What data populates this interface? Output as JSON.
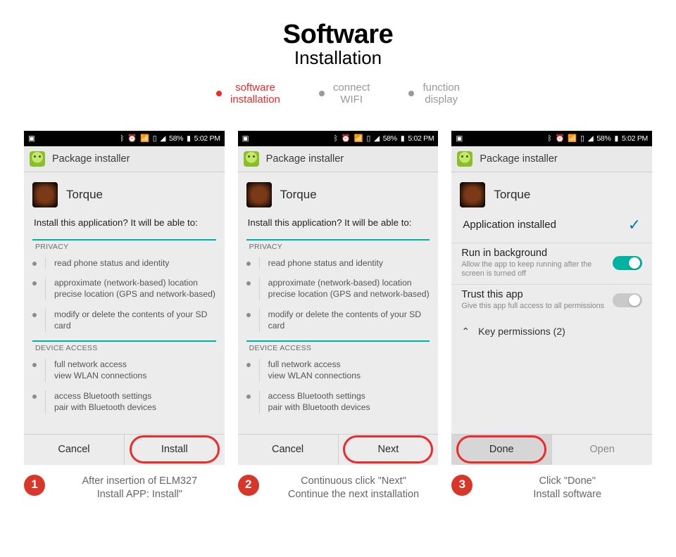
{
  "header": {
    "title": "Software",
    "subtitle": "Installation"
  },
  "tabs": {
    "t1a": "software",
    "t1b": "installation",
    "t2a": "connect",
    "t2b": "WIFI",
    "t3a": "function",
    "t3b": "display"
  },
  "statusbar": {
    "battery": "58%",
    "time": "5:02 PM"
  },
  "installer": {
    "header": "Package installer",
    "app_name": "Torque",
    "question": "Install this application? It will be able to:",
    "sect_privacy": "PRIVACY",
    "sect_device": "DEVICE ACCESS",
    "perm1": "read phone status and identity",
    "perm2a": "approximate (network-based) location",
    "perm2b": "precise location (GPS and network-based)",
    "perm3": "modify or delete the contents of your SD card",
    "perm4a": "full network access",
    "perm4b": "view WLAN connections",
    "perm5a": "access Bluetooth settings",
    "perm5b": "pair with Bluetooth devices"
  },
  "buttons": {
    "cancel": "Cancel",
    "install": "Install",
    "next": "Next",
    "done": "Done",
    "open": "Open"
  },
  "done_screen": {
    "installed": "Application installed",
    "run_bg_title": "Run in background",
    "run_bg_desc": "Allow the app to keep running after the screen is turned off",
    "trust_title": "Trust this app",
    "trust_desc": "Give this app full access to all permissions",
    "key_perms": "Key permissions (2)"
  },
  "captions": {
    "n1": "1",
    "c1a": "After insertion of ELM327",
    "c1b": "Install APP: Install\"",
    "n2": "2",
    "c2a": "Continuous click \"Next\"",
    "c2b": "Continue the next installation",
    "n3": "3",
    "c3a": "Click \"Done\"",
    "c3b": "Install software"
  }
}
